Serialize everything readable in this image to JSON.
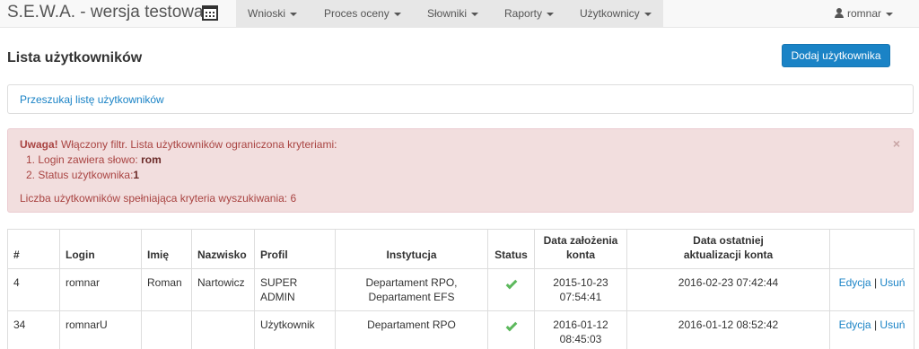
{
  "navbar": {
    "brand": "S.E.W.A. - wersja testowa",
    "menu": [
      {
        "label": "Wnioski"
      },
      {
        "label": "Proces oceny"
      },
      {
        "label": "Słowniki"
      },
      {
        "label": "Raporty"
      },
      {
        "label": "Użytkownicy"
      }
    ],
    "user": "romnar"
  },
  "page": {
    "title": "Lista użytkowników",
    "add_button": "Dodaj użytkownika",
    "search_link": "Przeszukaj listę użytkowników"
  },
  "alert": {
    "strong": "Uwaga!",
    "message": " Włączony filtr. Lista użytkowników ograniczona kryteriami:",
    "criteria": [
      {
        "num": "1.",
        "label": "Login zawiera słowo: ",
        "value": "rom"
      },
      {
        "num": "2.",
        "label": "Status użytkownika:",
        "value": "1"
      }
    ],
    "count_text": "Liczba użytkowników spełniająca kryteria wyszukiwania: 6",
    "close": "×"
  },
  "table": {
    "headers": {
      "num": "#",
      "login": "Login",
      "first_name": "Imię",
      "last_name": "Nazwisko",
      "profile": "Profil",
      "institution": "Instytucja",
      "status": "Status",
      "created_1": "Data założenia",
      "created_2": "konta",
      "updated_1": "Data ostatniej",
      "updated_2": "aktualizacji konta"
    },
    "rows": [
      {
        "num": "4",
        "login": "romnar",
        "first_name": "Roman",
        "last_name": "Nartowicz",
        "profile_1": "SUPER",
        "profile_2": "ADMIN",
        "institution_1": "Departament RPO,",
        "institution_2": "Departament EFS",
        "created_1": "2015-10-23",
        "created_2": "07:54:41",
        "updated": "2016-02-23 07:42:44",
        "edit": "Edycja",
        "sep": " | ",
        "delete": "Usuń"
      },
      {
        "num": "34",
        "login": "romnarU",
        "first_name": "",
        "last_name": "",
        "profile_1": "Użytkownik",
        "profile_2": "",
        "institution_1": "Departament RPO",
        "institution_2": "",
        "created_1": "2016-01-12",
        "created_2": "08:45:03",
        "updated": "2016-01-12 08:52:42",
        "edit": "Edycja",
        "sep": " | ",
        "delete": "Usuń"
      }
    ]
  },
  "colors": {
    "primary": "#1a83c6",
    "alert_bg": "#f2dede",
    "alert_text": "#a94442",
    "status_ok": "#5cb85c"
  }
}
